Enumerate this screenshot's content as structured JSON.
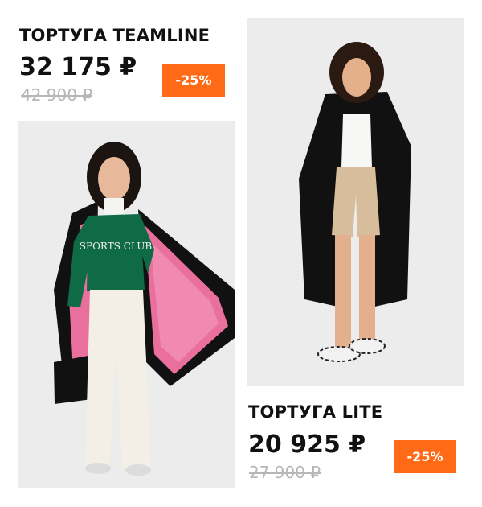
{
  "products": [
    {
      "title": "ТОРТУГА TEAMLINE",
      "price": "32 175 ₽",
      "old_price": "42 900 ₽",
      "discount": "-25%",
      "photo": "woman in long black parka with pink fleece lining, green sweatshirt and white trousers"
    },
    {
      "title": "ТОРТУГА LITE",
      "price": "20 925 ₽",
      "old_price": "27 900 ₽",
      "discount": "-25%",
      "photo": "woman in long black parka with sherpa collar, white top, beige shorts and zebra sandals"
    }
  ],
  "colors": {
    "accent": "#ff6a16",
    "text": "#111111",
    "muted": "#b7b7b7",
    "photo_bg": "#ececec"
  },
  "photo_texts": {
    "sweatshirt": "SPORTS CLUB"
  }
}
